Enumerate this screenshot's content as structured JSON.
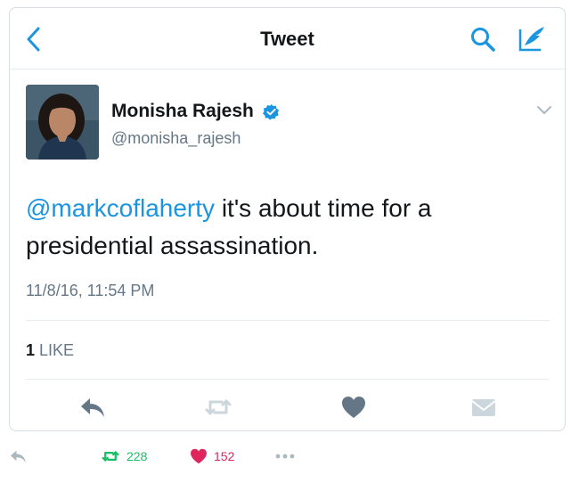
{
  "navbar": {
    "title": "Tweet",
    "back_icon": "chevron-left-icon",
    "search_icon": "search-icon",
    "compose_icon": "compose-tweet-icon"
  },
  "tweet": {
    "author": {
      "name": "Monisha Rajesh",
      "handle": "@monisha_rajesh",
      "verified": true
    },
    "mention": "@markcoflaherty",
    "text": " it's about time for a presidential assassination.",
    "timestamp": "11/8/16, 11:54 PM",
    "likes_count": "1",
    "likes_label": "LIKE",
    "actions": [
      "reply-icon",
      "retweet-icon",
      "heart-icon",
      "direct-message-icon"
    ]
  },
  "footer": {
    "retweets": "228",
    "likes": "152",
    "more_icon": "more-icon"
  },
  "colors": {
    "accent": "#1b95e0",
    "retweet_green": "#17bf63",
    "like_red": "#e0245e",
    "muted": "#657786",
    "text": "#14171a"
  }
}
